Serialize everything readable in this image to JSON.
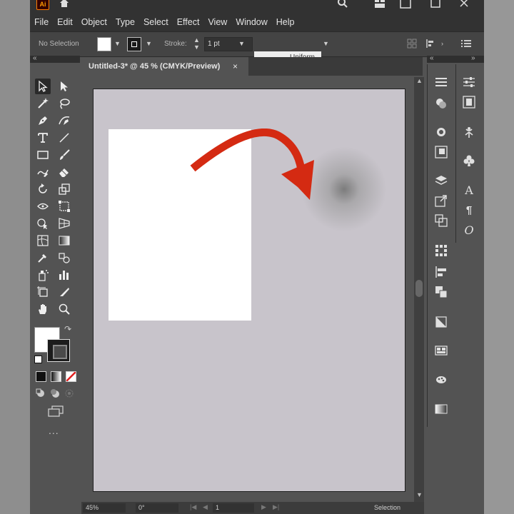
{
  "app": {
    "logo_text": "Ai"
  },
  "menu": [
    "File",
    "Edit",
    "Object",
    "Type",
    "Select",
    "Effect",
    "View",
    "Window",
    "Help"
  ],
  "control_bar": {
    "selection_label": "No Selection",
    "stroke_label": "Stroke:",
    "stroke_weight": "1 pt",
    "profile_label": "Uniform"
  },
  "document": {
    "tab_title": "Untitled-3* @ 45 % (CMYK/Preview)",
    "close_glyph": "×"
  },
  "status_bar": {
    "zoom": "45%",
    "rotation": "0°",
    "page_number": "1",
    "tool_readout": "Selection"
  },
  "tools_more": "...",
  "colors": {
    "app_bg": "#535353",
    "menubar": "#323232",
    "artboard_bg": "#c8c4cb",
    "arrow_red": "#d42a12"
  }
}
